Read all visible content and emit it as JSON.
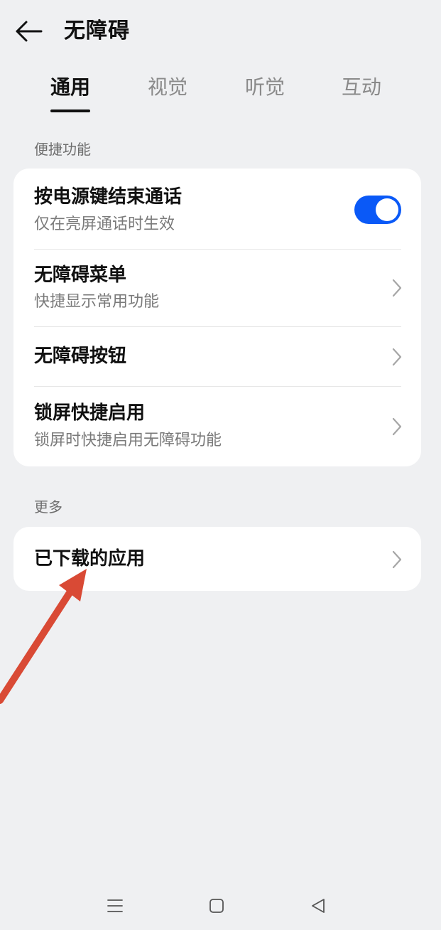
{
  "header": {
    "back_icon": "arrow-left-icon",
    "title": "无障碍"
  },
  "tabs": [
    {
      "label": "通用",
      "active": true
    },
    {
      "label": "视觉",
      "active": false
    },
    {
      "label": "听觉",
      "active": false
    },
    {
      "label": "互动",
      "active": false
    }
  ],
  "sections": [
    {
      "label": "便捷功能",
      "items": [
        {
          "title": "按电源键结束通话",
          "subtitle": "仅在亮屏通话时生效",
          "control": "toggle",
          "toggle_on": true
        },
        {
          "title": "无障碍菜单",
          "subtitle": "快捷显示常用功能",
          "control": "chevron"
        },
        {
          "title": "无障碍按钮",
          "subtitle": "",
          "control": "chevron"
        },
        {
          "title": "锁屏快捷启用",
          "subtitle": "锁屏时快捷启用无障碍功能",
          "control": "chevron"
        }
      ]
    },
    {
      "label": "更多",
      "items": [
        {
          "title": "已下载的应用",
          "subtitle": "",
          "control": "chevron"
        }
      ]
    }
  ],
  "navbar": {
    "menu_icon": "menu-lines-icon",
    "home_icon": "home-square-icon",
    "back_icon": "back-triangle-icon"
  },
  "colors": {
    "background": "#eff0f2",
    "card": "#ffffff",
    "accent": "#0a59f7",
    "annotation_arrow": "#d94a35"
  }
}
